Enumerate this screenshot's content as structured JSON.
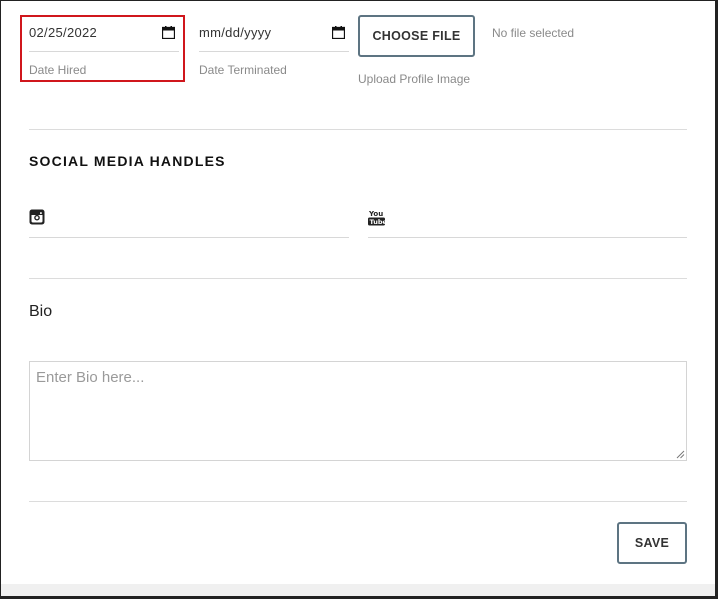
{
  "dates": {
    "hired": {
      "value": "02/25/2022",
      "label": "Date Hired"
    },
    "terminated": {
      "value": "mm/dd/yyyy",
      "label": "Date Terminated"
    }
  },
  "upload": {
    "button_label": "CHOOSE FILE",
    "status": "No file selected",
    "label": "Upload Profile Image"
  },
  "social": {
    "title": "SOCIAL MEDIA HANDLES",
    "instagram_icon": "instagram-icon",
    "youtube_icon": "youtube-icon",
    "instagram_value": "",
    "youtube_value": ""
  },
  "bio": {
    "label": "Bio",
    "placeholder": "Enter Bio here..."
  },
  "actions": {
    "save_label": "SAVE"
  },
  "colors": {
    "highlight": "#d0161c",
    "button_border": "#5d7482"
  }
}
